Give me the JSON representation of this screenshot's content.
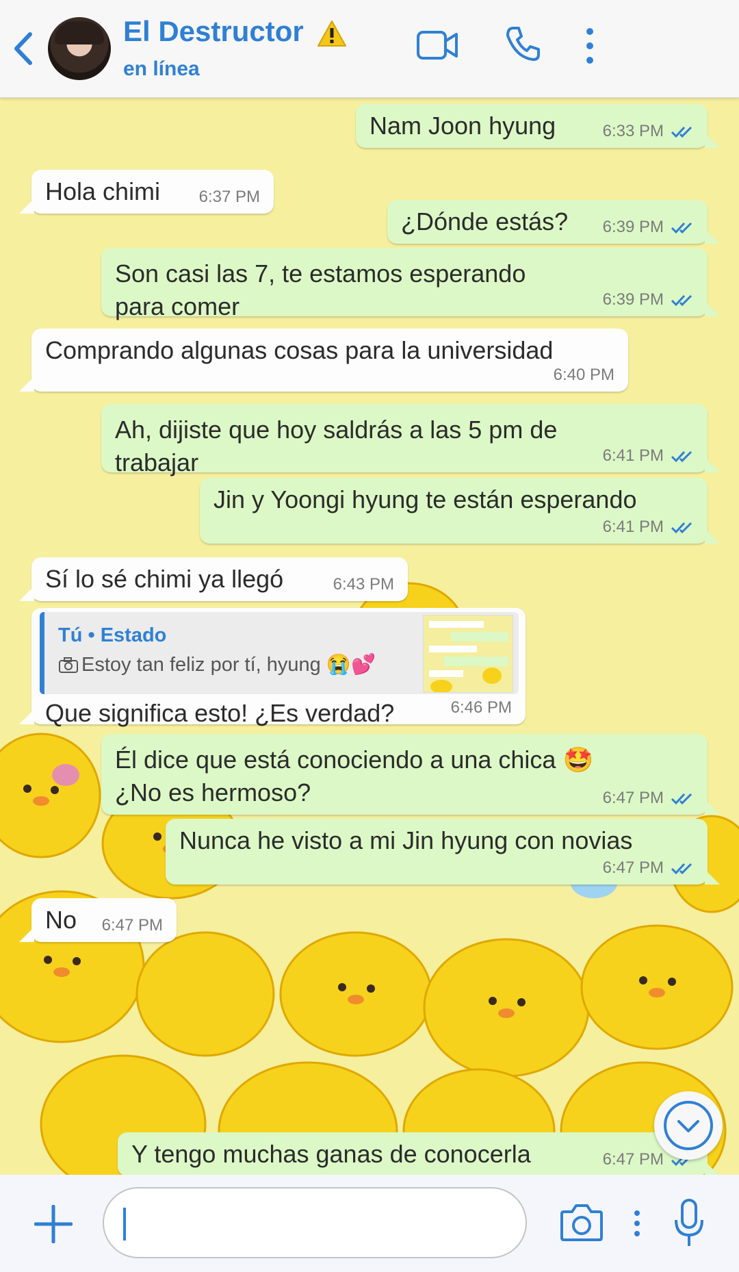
{
  "header": {
    "contact_name": "El Destructor",
    "status": "en línea",
    "warning_emoji": "⚠️",
    "icons": [
      "back-arrow-icon",
      "video-call-icon",
      "phone-icon",
      "more-options-icon"
    ]
  },
  "colors": {
    "accent": "#2f80d4",
    "outgoing_bubble": "#dcf8c6",
    "incoming_bubble": "#fdfdfd",
    "chat_background": "#f6ef9e",
    "chick_yellow": "#f6d21c"
  },
  "messages": [
    {
      "dir": "out",
      "text": "Nam Joon hyung",
      "time": "6:33 PM"
    },
    {
      "dir": "in",
      "text": "Hola chimi",
      "time": "6:37 PM"
    },
    {
      "dir": "out",
      "text": "¿Dónde estás?",
      "time": "6:39 PM"
    },
    {
      "dir": "out",
      "text": "Son casi las 7, te estamos esperando para comer",
      "time": "6:39 PM"
    },
    {
      "dir": "in",
      "text": "Comprando algunas cosas para la universidad",
      "time": "6:40 PM"
    },
    {
      "dir": "out",
      "text": "Ah, dijiste que hoy saldrás a las 5 pm de trabajar",
      "time": "6:41 PM"
    },
    {
      "dir": "out",
      "text": "Jin y Yoongi hyung te están esperando",
      "time": "6:41 PM"
    },
    {
      "dir": "in",
      "text": "Sí lo sé chimi ya llegó",
      "time": "6:43 PM"
    },
    {
      "dir": "in",
      "text": "Que significa esto! ¿Es verdad?",
      "time": "6:46 PM",
      "quote": {
        "author": "Tú • Estado",
        "text": "Estoy tan feliz por tí, hyung 😭💕"
      }
    },
    {
      "dir": "out",
      "text": "Él dice que está conociendo a una chica 🤩 ¿No es hermoso?",
      "time": "6:47 PM"
    },
    {
      "dir": "out",
      "text": "Nunca he visto a mi Jin hyung con novias",
      "time": "6:47 PM"
    },
    {
      "dir": "in",
      "text": "No",
      "time": "6:47 PM"
    },
    {
      "dir": "out",
      "text": "Y tengo muchas ganas de conocerla",
      "time": "6:47 PM"
    }
  ],
  "input": {
    "value": "",
    "icons": [
      "add-icon",
      "camera-icon",
      "more-dots-icon",
      "microphone-icon"
    ]
  },
  "scroll_button_icon": "chevron-down-icon"
}
